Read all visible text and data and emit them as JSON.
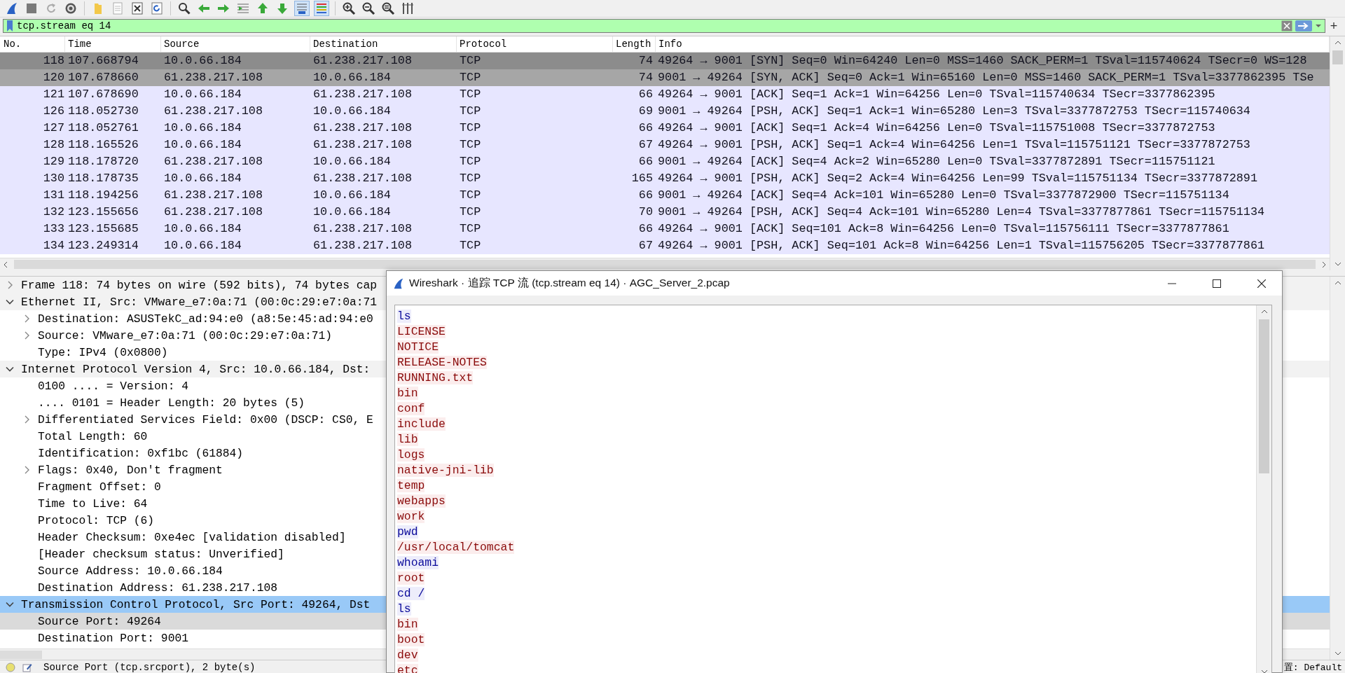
{
  "toolbar_buttons": [
    {
      "pressed": false
    },
    {
      "pressed": false
    },
    {
      "pressed": false
    },
    {
      "pressed": false
    },
    {
      "pressed": false
    },
    {
      "pressed": false
    },
    {
      "pressed": false
    },
    {
      "pressed": false
    },
    {
      "pressed": false
    },
    {
      "pressed": false
    },
    {
      "pressed": false
    },
    {
      "pressed": false
    },
    {
      "pressed": false
    },
    {
      "pressed": false
    },
    {
      "pressed": true
    },
    {
      "pressed": true
    },
    {
      "pressed": false
    },
    {
      "pressed": false
    },
    {
      "pressed": false
    },
    {
      "pressed": false
    }
  ],
  "display_filter": {
    "value": "tcp.stream eq 14",
    "valid": true,
    "add_button": "+"
  },
  "packet_list": {
    "columns": [
      "No.",
      "Time",
      "Source",
      "Destination",
      "Protocol",
      "Length",
      "Info"
    ],
    "rows": [
      {
        "no": "118",
        "time": "107.668794",
        "source": "10.0.66.184",
        "destination": "61.238.217.108",
        "protocol": "TCP",
        "length": "74",
        "info": "49264 → 9001 [SYN] Seq=0 Win=64240 Len=0 MSS=1460 SACK_PERM=1 TSval=115740624 TSecr=0 WS=128",
        "selected": true,
        "hovered": false
      },
      {
        "no": "120",
        "time": "107.678660",
        "source": "61.238.217.108",
        "destination": "10.0.66.184",
        "protocol": "TCP",
        "length": "74",
        "info": "9001 → 49264 [SYN, ACK] Seq=0 Ack=1 Win=65160 Len=0 MSS=1460 SACK_PERM=1 TSval=3377862395 TSe",
        "selected": false,
        "hovered": true
      },
      {
        "no": "121",
        "time": "107.678690",
        "source": "10.0.66.184",
        "destination": "61.238.217.108",
        "protocol": "TCP",
        "length": "66",
        "info": "49264 → 9001 [ACK] Seq=1 Ack=1 Win=64256 Len=0 TSval=115740634 TSecr=3377862395",
        "selected": false,
        "hovered": false
      },
      {
        "no": "126",
        "time": "118.052730",
        "source": "61.238.217.108",
        "destination": "10.0.66.184",
        "protocol": "TCP",
        "length": "69",
        "info": "9001 → 49264 [PSH, ACK] Seq=1 Ack=1 Win=65280 Len=3 TSval=3377872753 TSecr=115740634",
        "selected": false,
        "hovered": false
      },
      {
        "no": "127",
        "time": "118.052761",
        "source": "10.0.66.184",
        "destination": "61.238.217.108",
        "protocol": "TCP",
        "length": "66",
        "info": "49264 → 9001 [ACK] Seq=1 Ack=4 Win=64256 Len=0 TSval=115751008 TSecr=3377872753",
        "selected": false,
        "hovered": false
      },
      {
        "no": "128",
        "time": "118.165526",
        "source": "10.0.66.184",
        "destination": "61.238.217.108",
        "protocol": "TCP",
        "length": "67",
        "info": "49264 → 9001 [PSH, ACK] Seq=1 Ack=4 Win=64256 Len=1 TSval=115751121 TSecr=3377872753",
        "selected": false,
        "hovered": false
      },
      {
        "no": "129",
        "time": "118.178720",
        "source": "61.238.217.108",
        "destination": "10.0.66.184",
        "protocol": "TCP",
        "length": "66",
        "info": "9001 → 49264 [ACK] Seq=4 Ack=2 Win=65280 Len=0 TSval=3377872891 TSecr=115751121",
        "selected": false,
        "hovered": false
      },
      {
        "no": "130",
        "time": "118.178735",
        "source": "10.0.66.184",
        "destination": "61.238.217.108",
        "protocol": "TCP",
        "length": "165",
        "info": "49264 → 9001 [PSH, ACK] Seq=2 Ack=4 Win=64256 Len=99 TSval=115751134 TSecr=3377872891",
        "selected": false,
        "hovered": false
      },
      {
        "no": "131",
        "time": "118.194256",
        "source": "61.238.217.108",
        "destination": "10.0.66.184",
        "protocol": "TCP",
        "length": "66",
        "info": "9001 → 49264 [ACK] Seq=4 Ack=101 Win=65280 Len=0 TSval=3377872900 TSecr=115751134",
        "selected": false,
        "hovered": false
      },
      {
        "no": "132",
        "time": "123.155656",
        "source": "61.238.217.108",
        "destination": "10.0.66.184",
        "protocol": "TCP",
        "length": "70",
        "info": "9001 → 49264 [PSH, ACK] Seq=4 Ack=101 Win=65280 Len=4 TSval=3377877861 TSecr=115751134",
        "selected": false,
        "hovered": false
      },
      {
        "no": "133",
        "time": "123.155685",
        "source": "10.0.66.184",
        "destination": "61.238.217.108",
        "protocol": "TCP",
        "length": "66",
        "info": "49264 → 9001 [ACK] Seq=101 Ack=8 Win=64256 Len=0 TSval=115756111 TSecr=3377877861",
        "selected": false,
        "hovered": false
      },
      {
        "no": "134",
        "time": "123.249314",
        "source": "10.0.66.184",
        "destination": "61.238.217.108",
        "protocol": "TCP",
        "length": "67",
        "info": "49264 → 9001 [PSH, ACK] Seq=101 Ack=8 Win=64256 Len=1 TSval=115756205 TSecr=3377877861",
        "selected": false,
        "hovered": false
      }
    ]
  },
  "packet_details": [
    {
      "label": "Frame 118: 74 bytes on wire (592 bits), 74 bytes cap",
      "expanded": false,
      "selected": false,
      "hovered": false
    },
    {
      "label": "Ethernet II, Src: VMware_e7:0a:71 (00:0c:29:e7:0a:71",
      "expanded": true,
      "selected": false,
      "hovered": false,
      "children": [
        {
          "label": "Destination: ASUSTekC_ad:94:e0 (a8:5e:45:ad:94:e0",
          "expanded": false,
          "selected": false,
          "hovered": false
        },
        {
          "label": "Source: VMware_e7:0a:71 (00:0c:29:e7:0a:71)",
          "expanded": false,
          "selected": false,
          "hovered": false
        },
        {
          "label": "Type: IPv4 (0x0800)",
          "selected": false,
          "hovered": false
        }
      ]
    },
    {
      "label": "Internet Protocol Version 4, Src: 10.0.66.184, Dst:",
      "expanded": true,
      "selected": false,
      "hovered": false,
      "children": [
        {
          "label": "0100 .... = Version: 4",
          "selected": false,
          "hovered": false
        },
        {
          "label": ".... 0101 = Header Length: 20 bytes (5)",
          "selected": false,
          "hovered": false
        },
        {
          "label": "Differentiated Services Field: 0x00 (DSCP: CS0, E",
          "expanded": false,
          "selected": false,
          "hovered": false
        },
        {
          "label": "Total Length: 60",
          "selected": false,
          "hovered": false
        },
        {
          "label": "Identification: 0xf1bc (61884)",
          "selected": false,
          "hovered": false
        },
        {
          "label": "Flags: 0x40, Don't fragment",
          "expanded": false,
          "selected": false,
          "hovered": false
        },
        {
          "label": "Fragment Offset: 0",
          "selected": false,
          "hovered": false
        },
        {
          "label": "Time to Live: 64",
          "selected": false,
          "hovered": false
        },
        {
          "label": "Protocol: TCP (6)",
          "selected": false,
          "hovered": false
        },
        {
          "label": "Header Checksum: 0xe4ec [validation disabled]",
          "selected": false,
          "hovered": false
        },
        {
          "label": "[Header checksum status: Unverified]",
          "selected": false,
          "hovered": false
        },
        {
          "label": "Source Address: 10.0.66.184",
          "selected": false,
          "hovered": false
        },
        {
          "label": "Destination Address: 61.238.217.108",
          "selected": false,
          "hovered": false
        }
      ]
    },
    {
      "label": "Transmission Control Protocol, Src Port: 49264, Dst",
      "expanded": true,
      "selected": true,
      "hovered": false,
      "children": [
        {
          "label": "Source Port: 49264",
          "selected": false,
          "hovered": true
        },
        {
          "label": "Destination Port: 9001",
          "selected": false,
          "hovered": false
        }
      ]
    }
  ],
  "status_bar": {
    "field_info": "Source Port (tcp.srcport), 2 byte(s)",
    "profile": "置: Default"
  },
  "follow_dialog": {
    "title": "Wireshark · 追踪 TCP 流 (tcp.stream eq 14) · AGC_Server_2.pcap",
    "lines": [
      {
        "text": "ls",
        "kind": "server"
      },
      {
        "text": "LICENSE",
        "kind": "client"
      },
      {
        "text": "NOTICE",
        "kind": "client"
      },
      {
        "text": "RELEASE-NOTES",
        "kind": "client"
      },
      {
        "text": "RUNNING.txt",
        "kind": "client"
      },
      {
        "text": "bin",
        "kind": "client"
      },
      {
        "text": "conf",
        "kind": "client"
      },
      {
        "text": "include",
        "kind": "client"
      },
      {
        "text": "lib",
        "kind": "client"
      },
      {
        "text": "logs",
        "kind": "client"
      },
      {
        "text": "native-jni-lib",
        "kind": "client"
      },
      {
        "text": "temp",
        "kind": "client"
      },
      {
        "text": "webapps",
        "kind": "client"
      },
      {
        "text": "work",
        "kind": "client"
      },
      {
        "text": "pwd",
        "kind": "server"
      },
      {
        "text": "/usr/local/tomcat",
        "kind": "client"
      },
      {
        "text": "whoami",
        "kind": "server"
      },
      {
        "text": "root",
        "kind": "client"
      },
      {
        "text": "cd /",
        "kind": "server"
      },
      {
        "text": "ls",
        "kind": "server"
      },
      {
        "text": "bin",
        "kind": "client"
      },
      {
        "text": "boot",
        "kind": "client"
      },
      {
        "text": "dev",
        "kind": "client"
      },
      {
        "text": "etc",
        "kind": "client"
      }
    ]
  }
}
